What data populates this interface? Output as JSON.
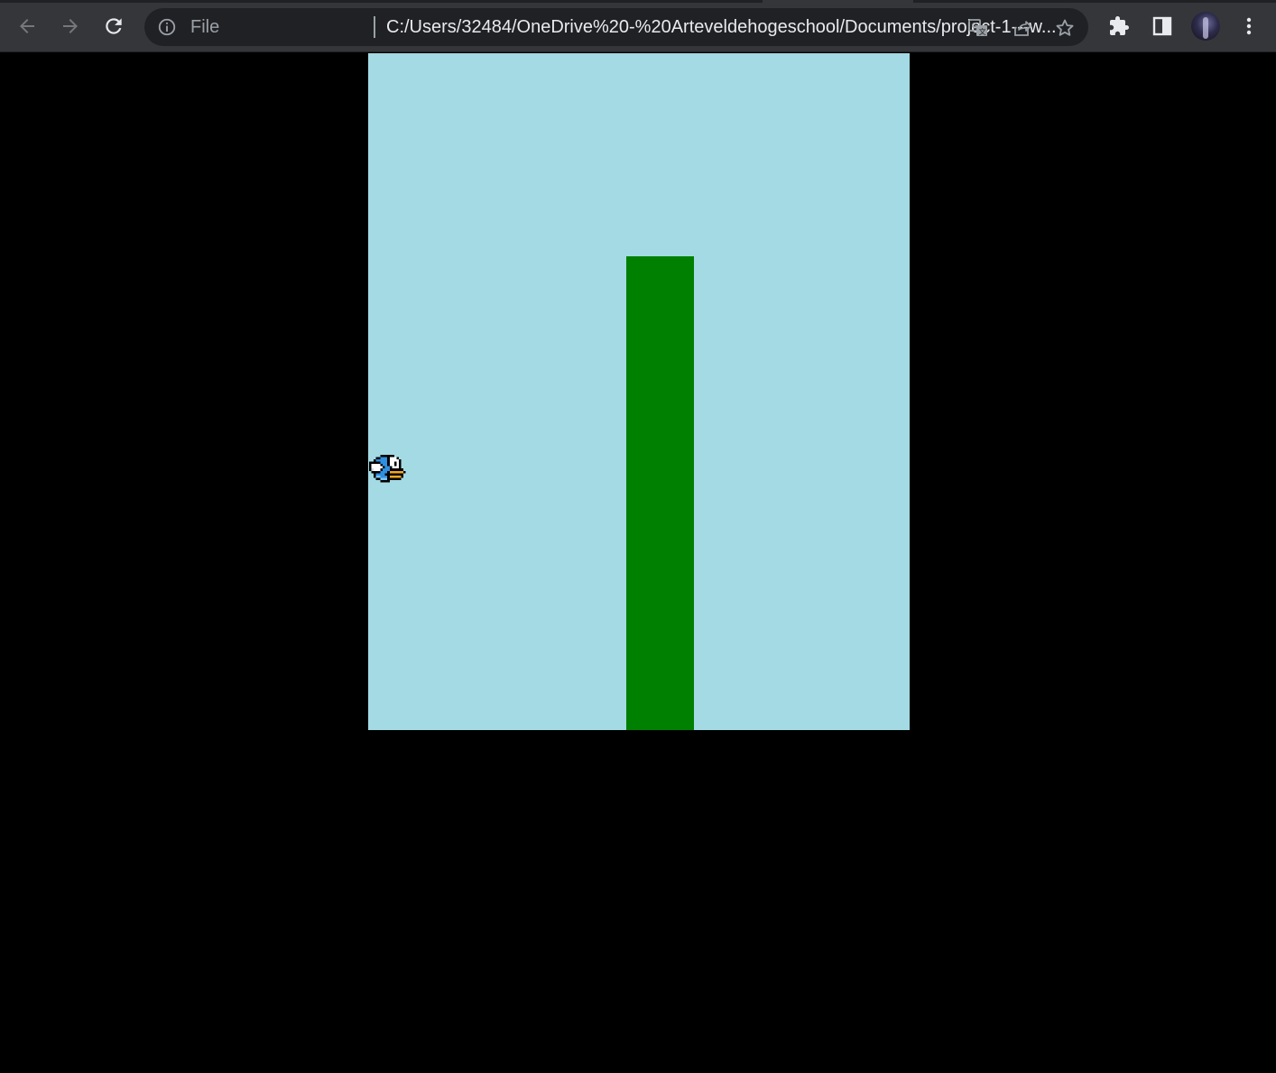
{
  "browser": {
    "url_scheme": "File",
    "url": "C:/Users/32484/OneDrive%20-%20Arteveldehogeschool/Documents/project-1---w...",
    "icons": {
      "back": "arrow-left-icon",
      "forward": "arrow-right-icon",
      "reload": "reload-icon",
      "site_info": "info-circle-icon",
      "translate": "translate-icon",
      "share": "share-icon",
      "bookmark": "star-icon",
      "extensions": "puzzle-icon",
      "side_panel": "side-panel-icon",
      "menu": "kebab-menu-icon"
    },
    "colors": {
      "toolbar": "#35363a",
      "omnibox": "#202124",
      "icon": "#e8eaed",
      "icon_disabled": "#75777b"
    }
  },
  "game": {
    "sky_color": "#a4dae3",
    "pipe_color": "#008000",
    "page_background": "#000000",
    "bird_sprite": "blue-bird-icon"
  }
}
